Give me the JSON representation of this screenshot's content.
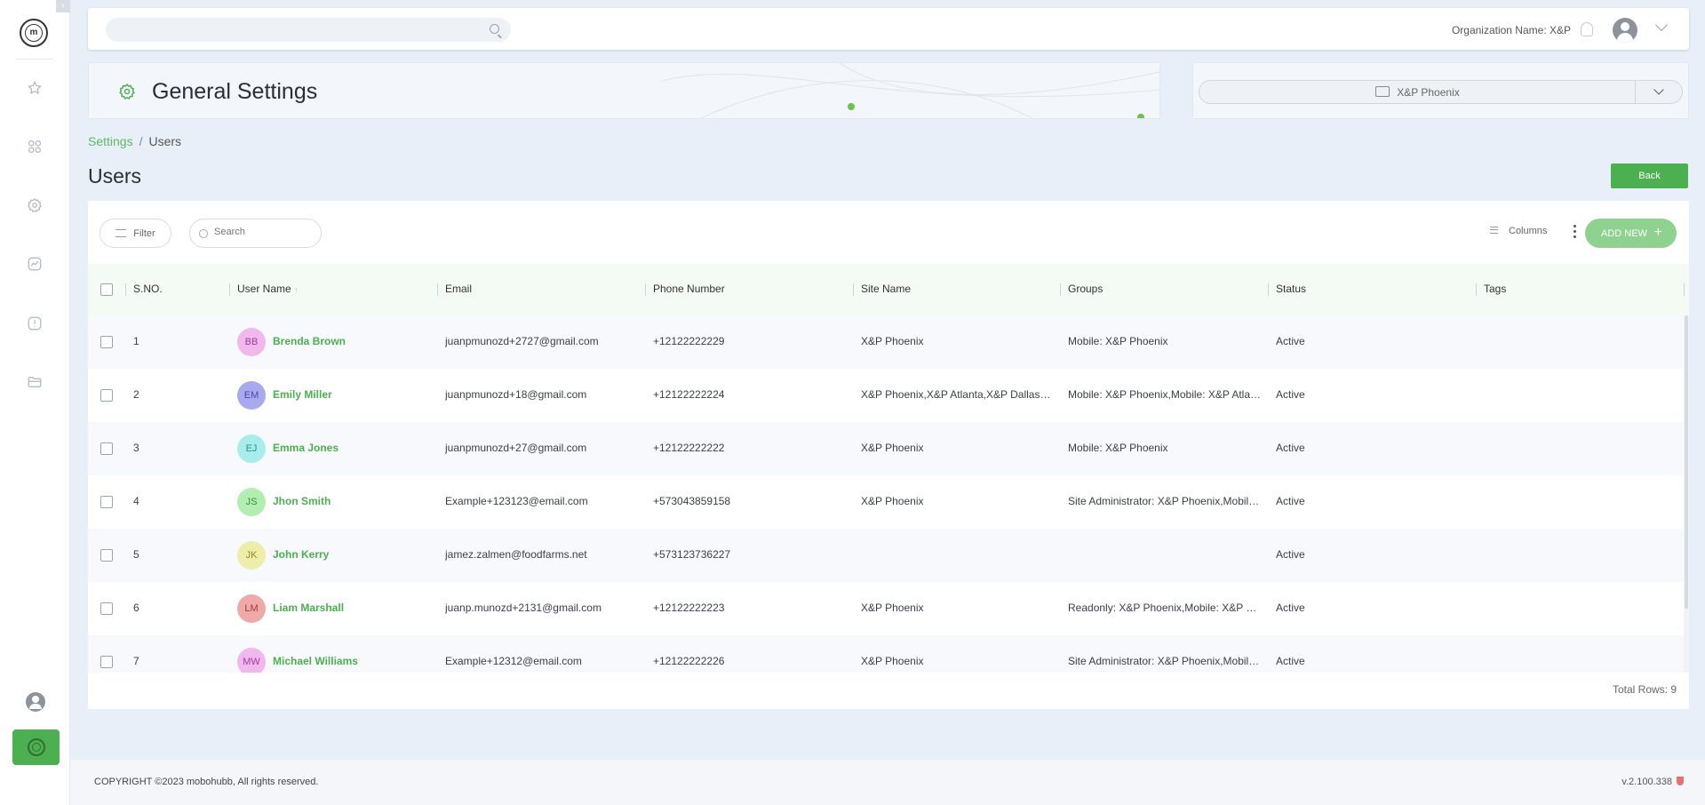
{
  "topbar": {
    "search_placeholder": "",
    "org_label": "Organization Name: X&P"
  },
  "header": {
    "title": "General Settings",
    "site_selected": "X&P Phoenix"
  },
  "breadcrumb": {
    "parent": "Settings",
    "separator": "/",
    "current": "Users"
  },
  "page": {
    "title": "Users",
    "back_label": "Back"
  },
  "toolbar": {
    "filter_label": "Filter",
    "search_placeholder": "Search",
    "columns_label": "Columns",
    "add_new_label": "ADD NEW"
  },
  "table": {
    "columns": [
      "S.NO.",
      "User Name",
      "Email",
      "Phone Number",
      "Site Name",
      "Groups",
      "Status",
      "Tags"
    ],
    "sort_indicator": "↑",
    "rows": [
      {
        "sno": "1",
        "initials": "BB",
        "name": "Brenda Brown",
        "email": "juanpmunozd+2727@gmail.com",
        "phone": "+12122222229",
        "site": "X&P Phoenix",
        "groups": "Mobile: X&P Phoenix",
        "status": "Active",
        "tags": "",
        "avatar_bg": "#f0b8ec",
        "avatar_fg": "#a33a9b"
      },
      {
        "sno": "2",
        "initials": "EM",
        "name": "Emily Miller",
        "email": "juanpmunozd+18@gmail.com",
        "phone": "+12122222224",
        "site": "X&P Phoenix,X&P Atlanta,X&P Dallas,X&...",
        "groups": "Mobile: X&P Phoenix,Mobile: X&P Atlant...",
        "status": "Active",
        "tags": "",
        "avatar_bg": "#a9a9f0",
        "avatar_fg": "#4949a8"
      },
      {
        "sno": "3",
        "initials": "EJ",
        "name": "Emma Jones",
        "email": "juanpmunozd+27@gmail.com",
        "phone": "+12122222222",
        "site": "X&P Phoenix",
        "groups": "Mobile: X&P Phoenix",
        "status": "Active",
        "tags": "",
        "avatar_bg": "#a9ecec",
        "avatar_fg": "#2f8d8d"
      },
      {
        "sno": "4",
        "initials": "JS",
        "name": "Jhon Smith",
        "email": "Example+123123@email.com",
        "phone": "+573043859158",
        "site": "X&P Phoenix",
        "groups": "Site Administrator: X&P Phoenix,Mobile: ...",
        "status": "Active",
        "tags": "",
        "avatar_bg": "#b2eeb2",
        "avatar_fg": "#3a8d3a"
      },
      {
        "sno": "5",
        "initials": "JK",
        "name": "John Kerry",
        "email": "jamez.zalmen@foodfarms.net",
        "phone": "+573123736227",
        "site": "",
        "groups": "",
        "status": "Active",
        "tags": "",
        "avatar_bg": "#eeeeaa",
        "avatar_fg": "#8d8d2a"
      },
      {
        "sno": "6",
        "initials": "LM",
        "name": "Liam Marshall",
        "email": "juanp.munozd+2131@gmail.com",
        "phone": "+12122222223",
        "site": "X&P Phoenix",
        "groups": "Readonly: X&P Phoenix,Mobile: X&P Pho...",
        "status": "Active",
        "tags": "",
        "avatar_bg": "#f0a9a9",
        "avatar_fg": "#a33a3a"
      },
      {
        "sno": "7",
        "initials": "MW",
        "name": "Michael Williams",
        "email": "Example+12312@email.com",
        "phone": "+12122222226",
        "site": "X&P Phoenix",
        "groups": "Site Administrator: X&P Phoenix,Mobile: ...",
        "status": "Active",
        "tags": "",
        "avatar_bg": "#f0b8ec",
        "avatar_fg": "#a33a9b"
      }
    ],
    "total_rows": "Total Rows: 9"
  },
  "footer": {
    "copyright": "COPYRIGHT ©2023 mobohubb, All rights reserved.",
    "version": "v.2.100.338"
  },
  "colors": {
    "accent": "#4caf50",
    "link": "#5dbb63",
    "add_button": "#8fd18f"
  },
  "icons": {
    "sidebar": [
      "logo-icon",
      "star-icon",
      "apps-icon",
      "gear-icon",
      "chart-icon",
      "alert-icon",
      "folder-icon",
      "user-icon",
      "brand-icon"
    ],
    "topbar": [
      "search-icon",
      "bell-icon",
      "avatar-icon",
      "chevron-down-icon"
    ]
  }
}
